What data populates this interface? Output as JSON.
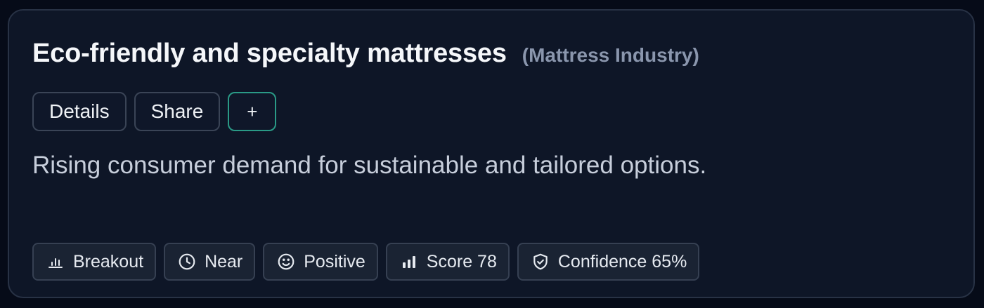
{
  "card": {
    "title": "Eco-friendly and specialty mattresses",
    "category": "(Mattress Industry)",
    "description": "Rising consumer demand for sustainable and tailored options."
  },
  "actions": {
    "details_label": "Details",
    "share_label": "Share",
    "add_label": "+"
  },
  "tags": [
    {
      "icon": "bar-chart-icon",
      "label": "Breakout"
    },
    {
      "icon": "clock-icon",
      "label": "Near"
    },
    {
      "icon": "smiley-icon",
      "label": "Positive"
    },
    {
      "icon": "signal-bars-icon",
      "label": "Score 78"
    },
    {
      "icon": "shield-check-icon",
      "label": "Confidence 65%"
    }
  ],
  "colors": {
    "background": "#060b18",
    "card": "#0e1627",
    "accent_border": "#2a9a86"
  }
}
